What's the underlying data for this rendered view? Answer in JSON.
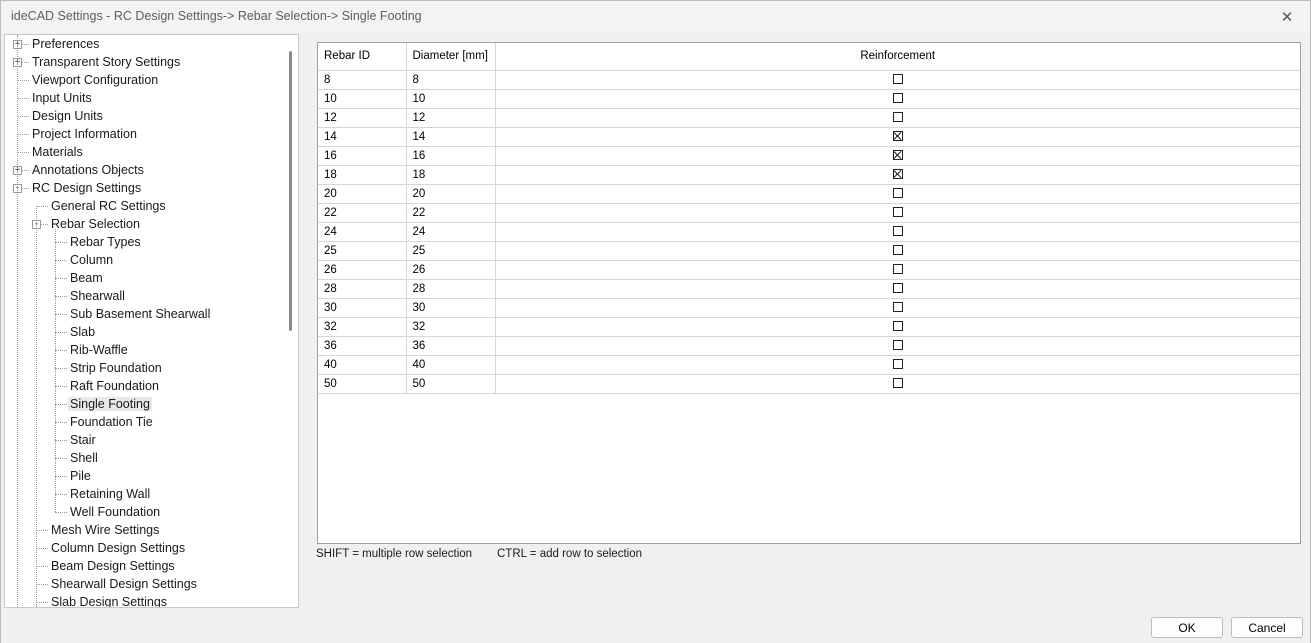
{
  "window": {
    "title": "ideCAD Settings - RC Design Settings-> Rebar Selection-> Single Footing"
  },
  "tree": {
    "items": [
      {
        "label": "Preferences",
        "level": 0,
        "expander": "+"
      },
      {
        "label": "Transparent Story Settings",
        "level": 0,
        "expander": "+"
      },
      {
        "label": "Viewport Configuration",
        "level": 0
      },
      {
        "label": "Input Units",
        "level": 0
      },
      {
        "label": "Design Units",
        "level": 0
      },
      {
        "label": "Project Information",
        "level": 0
      },
      {
        "label": "Materials",
        "level": 0
      },
      {
        "label": "Annotations Objects",
        "level": 0,
        "expander": "+"
      },
      {
        "label": "RC Design Settings",
        "level": 0,
        "expander": "-"
      },
      {
        "label": "General RC Settings",
        "level": 1
      },
      {
        "label": "Rebar Selection",
        "level": 1,
        "expander": "-"
      },
      {
        "label": "Rebar Types",
        "level": 2
      },
      {
        "label": "Column",
        "level": 2
      },
      {
        "label": "Beam",
        "level": 2
      },
      {
        "label": "Shearwall",
        "level": 2
      },
      {
        "label": "Sub Basement Shearwall",
        "level": 2
      },
      {
        "label": "Slab",
        "level": 2
      },
      {
        "label": "Rib-Waffle",
        "level": 2
      },
      {
        "label": "Strip Foundation",
        "level": 2
      },
      {
        "label": "Raft Foundation",
        "level": 2
      },
      {
        "label": "Single Footing",
        "level": 2,
        "selected": true
      },
      {
        "label": "Foundation Tie",
        "level": 2
      },
      {
        "label": "Stair",
        "level": 2
      },
      {
        "label": "Shell",
        "level": 2
      },
      {
        "label": "Pile",
        "level": 2
      },
      {
        "label": "Retaining Wall",
        "level": 2
      },
      {
        "label": "Well Foundation",
        "level": 2
      },
      {
        "label": "Mesh Wire Settings",
        "level": 1
      },
      {
        "label": "Column Design Settings",
        "level": 1
      },
      {
        "label": "Beam Design Settings",
        "level": 1
      },
      {
        "label": "Shearwall Design Settings",
        "level": 1
      },
      {
        "label": "Slab Design Settings",
        "level": 1
      }
    ]
  },
  "grid": {
    "columns": [
      "Rebar ID",
      "Diameter [mm]",
      "Reinforcement"
    ],
    "rows": [
      {
        "id": "8",
        "diameter": "8",
        "checked": false
      },
      {
        "id": "10",
        "diameter": "10",
        "checked": false
      },
      {
        "id": "12",
        "diameter": "12",
        "checked": false
      },
      {
        "id": "14",
        "diameter": "14",
        "checked": true
      },
      {
        "id": "16",
        "diameter": "16",
        "checked": true
      },
      {
        "id": "18",
        "diameter": "18",
        "checked": true
      },
      {
        "id": "20",
        "diameter": "20",
        "checked": false
      },
      {
        "id": "22",
        "diameter": "22",
        "checked": false
      },
      {
        "id": "24",
        "diameter": "24",
        "checked": false
      },
      {
        "id": "25",
        "diameter": "25",
        "checked": false
      },
      {
        "id": "26",
        "diameter": "26",
        "checked": false
      },
      {
        "id": "28",
        "diameter": "28",
        "checked": false
      },
      {
        "id": "30",
        "diameter": "30",
        "checked": false
      },
      {
        "id": "32",
        "diameter": "32",
        "checked": false
      },
      {
        "id": "36",
        "diameter": "36",
        "checked": false
      },
      {
        "id": "40",
        "diameter": "40",
        "checked": false
      },
      {
        "id": "50",
        "diameter": "50",
        "checked": false
      }
    ]
  },
  "hints": {
    "shift": "SHIFT = multiple row selection",
    "ctrl": "CTRL = add row to selection"
  },
  "buttons": {
    "ok": "OK",
    "cancel": "Cancel"
  },
  "icons": {
    "close": "close-icon",
    "expand": "plus-box-icon",
    "collapse": "minus-box-icon"
  }
}
